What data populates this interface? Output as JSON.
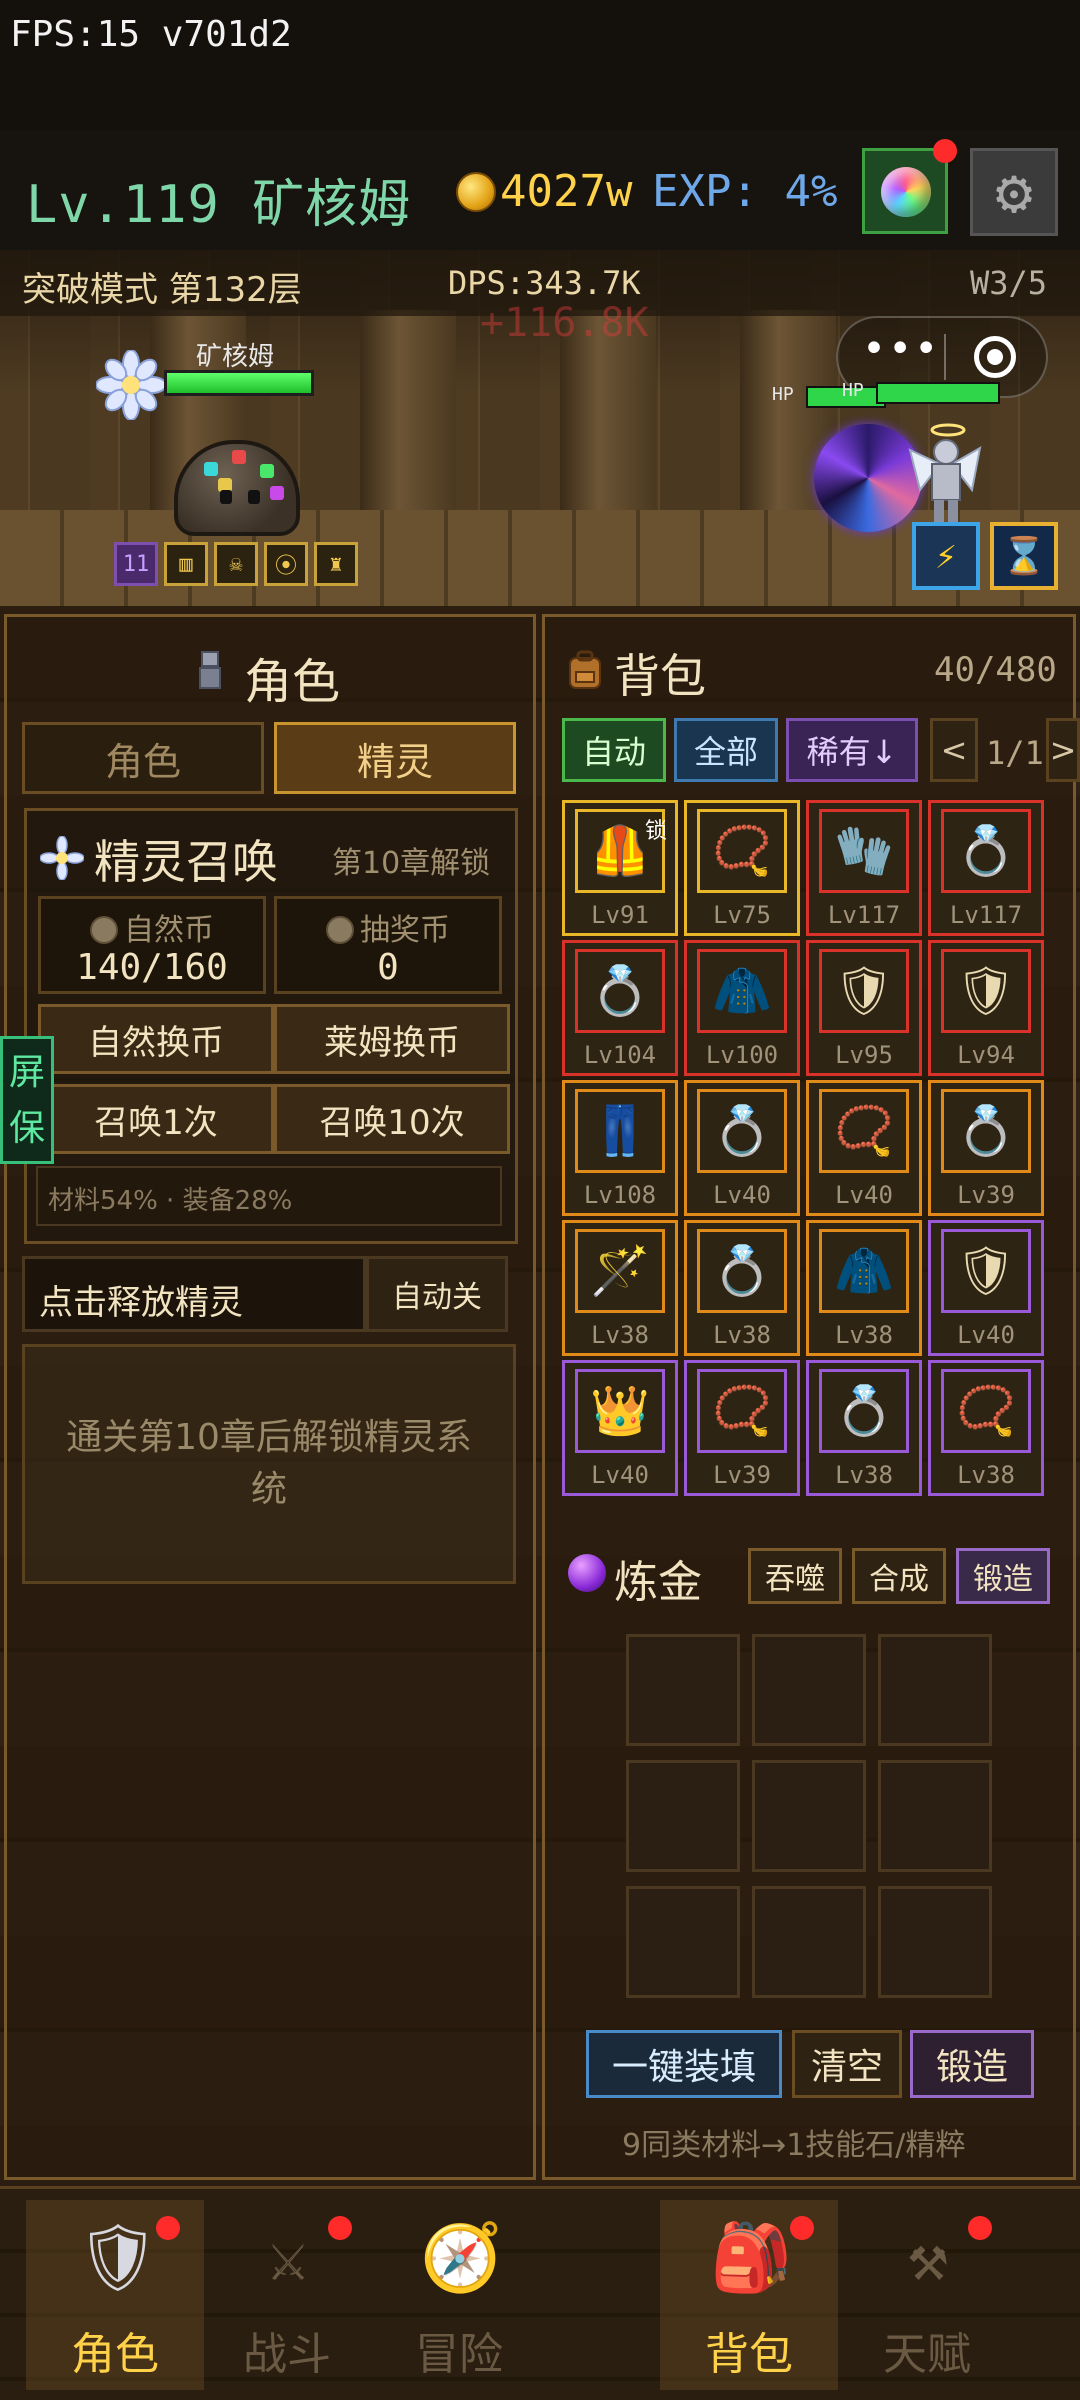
{
  "status": {
    "fps": "FPS:15 v701d2"
  },
  "header": {
    "level_name": "Lv.119 矿核姆",
    "gold": "4027w",
    "exp": "EXP: 4%",
    "colors": {
      "level": "#7fd6a8",
      "gold": "#ffd24a",
      "exp": "#6fa8e8"
    }
  },
  "battle": {
    "mode": "突破模式 第132层",
    "dps": "DPS:343.7K",
    "wave": "W3/5",
    "floating_damage": "+116.8K",
    "player_name": "矿核姆",
    "player_hp_fraction": 1.0,
    "buff_count": "11",
    "enemy_hp_label": "HP",
    "enemy_hp_fraction": 1.0
  },
  "role_panel": {
    "title": "角色",
    "tabs": [
      "角色",
      "精灵"
    ],
    "active_tab": 1,
    "spirit": {
      "title": "精灵召唤",
      "unlock": "第10章解锁",
      "nature_coin_label": "自然币",
      "nature_coin_value": "140/160",
      "lottery_coin_label": "抽奖币",
      "lottery_coin_value": "0",
      "buttons": [
        "自然换币",
        "莱姆换币",
        "召唤1次",
        "召唤10次"
      ],
      "rates": "材料54% · 装备28%"
    },
    "release_label": "点击释放精灵",
    "auto_toggle": "自动关",
    "locked_text": "通关第10章后解锁精灵系统"
  },
  "screensaver": "屏保",
  "bag": {
    "title": "背包",
    "count": "40/480",
    "filters": {
      "auto": "自动",
      "all": "全部",
      "rare": "稀有↓",
      "prev": "<",
      "page": "1/1",
      "next": ">"
    },
    "lock_label": "锁",
    "items": [
      {
        "lv": "Lv91",
        "icon": "chest-armor-icon",
        "glyph": "🦺",
        "rarity": "gold"
      },
      {
        "lv": "Lv75",
        "icon": "amulet-icon",
        "glyph": "📿",
        "rarity": "gold"
      },
      {
        "lv": "Lv117",
        "icon": "glove-icon",
        "glyph": "🧤",
        "rarity": "red"
      },
      {
        "lv": "Lv117",
        "icon": "ring-icon",
        "glyph": "💍",
        "rarity": "red"
      },
      {
        "lv": "Lv104",
        "icon": "ring-icon",
        "glyph": "💍",
        "rarity": "red"
      },
      {
        "lv": "Lv100",
        "icon": "cape-icon",
        "glyph": "🧥",
        "rarity": "red"
      },
      {
        "lv": "Lv95",
        "icon": "chest-armor-icon",
        "glyph": "🛡",
        "rarity": "red"
      },
      {
        "lv": "Lv94",
        "icon": "chest-armor-icon",
        "glyph": "🛡",
        "rarity": "red"
      },
      {
        "lv": "Lv108",
        "icon": "pants-icon",
        "glyph": "👖",
        "rarity": "orange"
      },
      {
        "lv": "Lv40",
        "icon": "ring-icon",
        "glyph": "💍",
        "rarity": "orange"
      },
      {
        "lv": "Lv40",
        "icon": "amulet-icon",
        "glyph": "📿",
        "rarity": "orange"
      },
      {
        "lv": "Lv39",
        "icon": "ring-icon",
        "glyph": "💍",
        "rarity": "orange"
      },
      {
        "lv": "Lv38",
        "icon": "staff-icon",
        "glyph": "🪄",
        "rarity": "orange"
      },
      {
        "lv": "Lv38",
        "icon": "ring-icon",
        "glyph": "💍",
        "rarity": "orange"
      },
      {
        "lv": "Lv38",
        "icon": "cape-icon",
        "glyph": "🧥",
        "rarity": "orange"
      },
      {
        "lv": "Lv40",
        "icon": "chainmail-icon",
        "glyph": "🛡",
        "rarity": "purple"
      },
      {
        "lv": "Lv40",
        "icon": "crown-icon",
        "glyph": "👑",
        "rarity": "purple"
      },
      {
        "lv": "Lv39",
        "icon": "amulet-icon",
        "glyph": "📿",
        "rarity": "purple"
      },
      {
        "lv": "Lv38",
        "icon": "ring-icon",
        "glyph": "💍",
        "rarity": "purple"
      },
      {
        "lv": "Lv38",
        "icon": "amulet-icon",
        "glyph": "📿",
        "rarity": "purple"
      }
    ],
    "rarity_colors": {
      "gold": "#e8b828",
      "red": "#d8322a",
      "orange": "#e08a1a",
      "purple": "#9a5ad8"
    }
  },
  "alchemy": {
    "title": "炼金",
    "buttons": [
      "吞噬",
      "合成",
      "锻造"
    ],
    "actions": {
      "fill": "一键装填",
      "clear": "清空",
      "forge": "锻造"
    },
    "hint": "9同类材料→1技能石/精粹"
  },
  "nav": {
    "items": [
      {
        "label": "角色",
        "icon": "knight-icon",
        "glyph": "🛡",
        "active": true,
        "dot": true
      },
      {
        "label": "战斗",
        "icon": "sword-icon",
        "glyph": "⚔",
        "active": false,
        "dot": true
      },
      {
        "label": "冒险",
        "icon": "compass-icon",
        "glyph": "🧭",
        "active": false,
        "dot": false
      },
      {
        "label": "背包",
        "icon": "backpack-icon",
        "glyph": "🎒",
        "active": true,
        "dot": true
      },
      {
        "label": "天赋",
        "icon": "anvil-icon",
        "glyph": "⚒",
        "active": false,
        "dot": true
      }
    ]
  }
}
